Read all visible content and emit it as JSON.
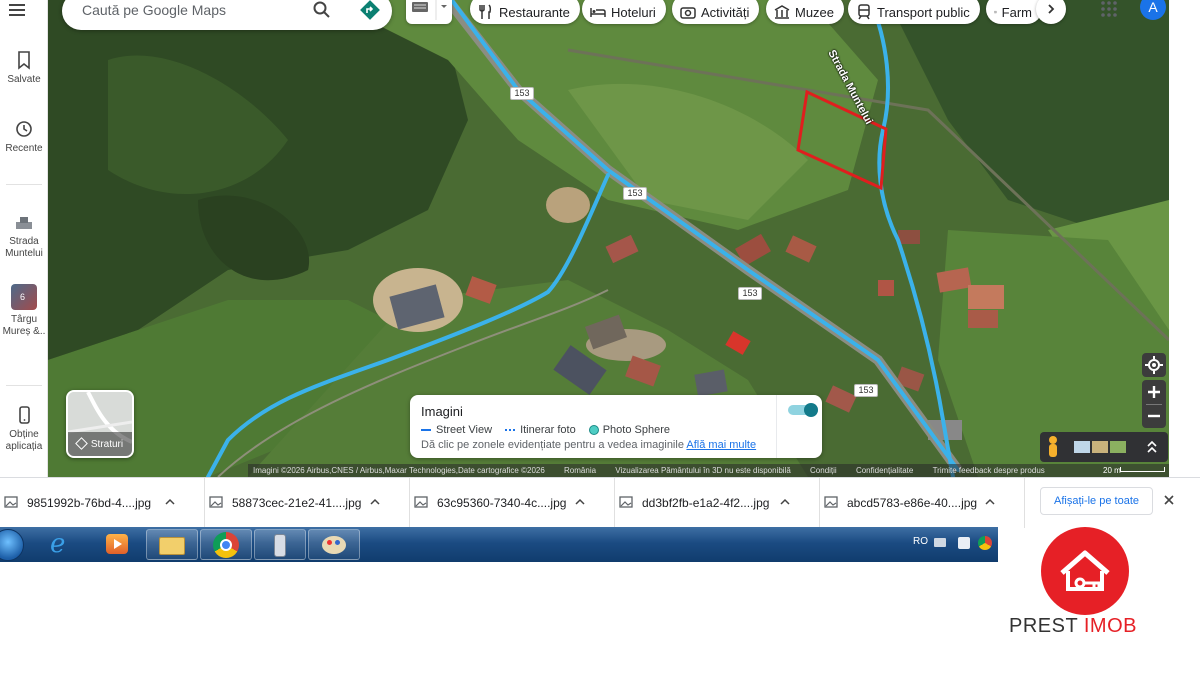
{
  "search": {
    "placeholder": "Caută pe Google Maps"
  },
  "rail": {
    "menu_icon": "hamburger-icon",
    "items": [
      {
        "label": "Salvate",
        "icon": "bookmark-icon"
      },
      {
        "label": "Recente",
        "icon": "history-icon"
      },
      {
        "label": "Strada Muntelui",
        "icon": "road-icon"
      },
      {
        "label": "Târgu Mureș &..",
        "icon": "place-thumbnail",
        "badge": "6"
      },
      {
        "label": "Obține aplicația",
        "icon": "phone-icon"
      }
    ]
  },
  "categories": [
    {
      "label": "Restaurante",
      "icon": "fork-knife-icon"
    },
    {
      "label": "Hoteluri",
      "icon": "bed-icon"
    },
    {
      "label": "Activități",
      "icon": "camera-icon"
    },
    {
      "label": "Muzee",
      "icon": "museum-icon"
    },
    {
      "label": "Transport public",
      "icon": "train-icon"
    },
    {
      "label": "Farm",
      "icon": "pharmacy-icon"
    }
  ],
  "account": {
    "initial": "A",
    "color": "#1a73e8"
  },
  "map": {
    "road_labels": [
      {
        "text": "153"
      },
      {
        "text": "153"
      },
      {
        "text": "153"
      },
      {
        "text": "153"
      }
    ],
    "street_name": "Strada Muntelui",
    "plot_color": "#e01e1e",
    "route_color": "#3bb2ea"
  },
  "layers": {
    "label": "Straturi"
  },
  "imagery_card": {
    "title": "Imagini",
    "legend": [
      {
        "label": "Street View",
        "kind": "line"
      },
      {
        "label": "Itinerar foto",
        "kind": "dash"
      },
      {
        "label": "Photo Sphere",
        "kind": "dot"
      }
    ],
    "hint": "Dă clic pe zonele evidențiate pentru a vedea imaginile",
    "link": "Află mai multe",
    "toggle_on": true
  },
  "attribution": {
    "items": [
      "Imagini ©2026 Airbus,CNES / Airbus,Maxar Technologies,Date cartografice ©2026",
      "România",
      "Vizualizarea Pământului în 3D nu este disponibilă",
      "Condiții",
      "Confidențialitate",
      "Trimite feedback despre produs"
    ],
    "scale": "20 m"
  },
  "downloads": {
    "files": [
      "9851992b-76bd-4....jpg",
      "58873cec-21e2-41....jpg",
      "63c95360-7340-4c....jpg",
      "dd3bf2fb-e1a2-4f2....jpg",
      "abcd5783-e86e-40....jpg"
    ],
    "show_all": "Afișați-le pe toate"
  },
  "taskbar": {
    "apps": [
      "start-orb-icon",
      "internet-explorer-icon",
      "media-player-icon",
      "file-explorer-icon",
      "chrome-icon",
      "phone-app-icon",
      "paint-icon"
    ],
    "tray_lang": "RO"
  },
  "logo": {
    "brand_left": "PREST ",
    "brand_right": "IMOB",
    "color": "#e62026"
  }
}
